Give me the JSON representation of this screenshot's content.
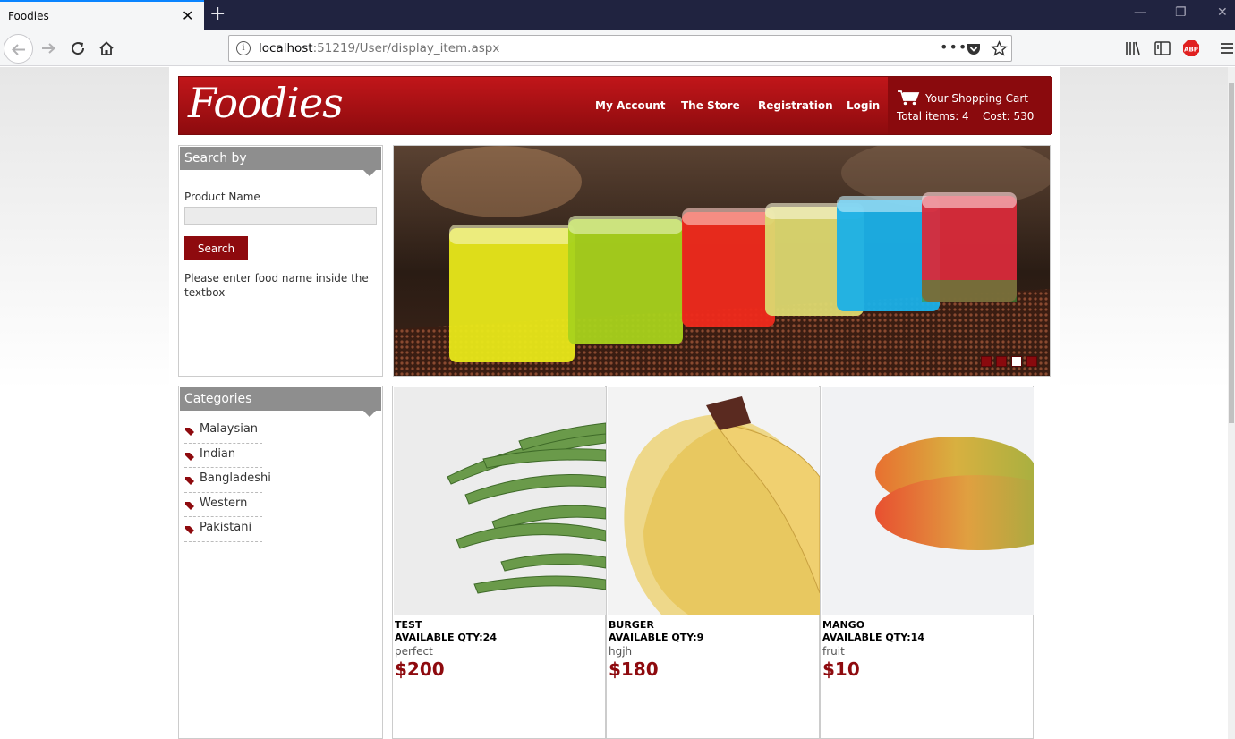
{
  "browser": {
    "tab_title": "Foodies",
    "tab_close": "✕",
    "new_tab": "+",
    "url_host": "localhost",
    "url_rest": ":51219/User/display_item.aspx",
    "url_info": "i",
    "url_more": "•••",
    "window_buttons": [
      "—",
      "❐",
      "✕"
    ]
  },
  "header": {
    "logo": "Foodies",
    "menu": [
      "My Account",
      "The Store",
      "Registration",
      "Login"
    ],
    "cart_title": "Your Shopping Cart",
    "cart_info": "Total items: 4    Cost: 530"
  },
  "search": {
    "heading": "Search by",
    "label": "Product Name",
    "value": "",
    "button": "Search",
    "hint": "Please enter food name inside the textbox"
  },
  "categories": {
    "heading": "Categories",
    "items": [
      "Malaysian",
      "Indian",
      "Bangladeshi",
      "Western",
      "Pakistani"
    ]
  },
  "slider": {
    "slide_count": 4,
    "active_slide": 3
  },
  "products": [
    {
      "name": "TEST",
      "qty": "AVAILABLE QTY:24",
      "desc": "perfect",
      "price": "$200",
      "image": "green-beans"
    },
    {
      "name": "BURGER",
      "qty": "AVAILABLE QTY:9",
      "desc": "hgjh",
      "price": "$180",
      "image": "bananas"
    },
    {
      "name": "MANGO",
      "qty": "AVAILABLE QTY:14",
      "desc": "fruit",
      "price": "$10",
      "image": "mango"
    }
  ],
  "colors": {
    "brand_red": "#8e0a0e",
    "panel_grey": "#8e8e8e",
    "chrome_dark": "#202340"
  }
}
